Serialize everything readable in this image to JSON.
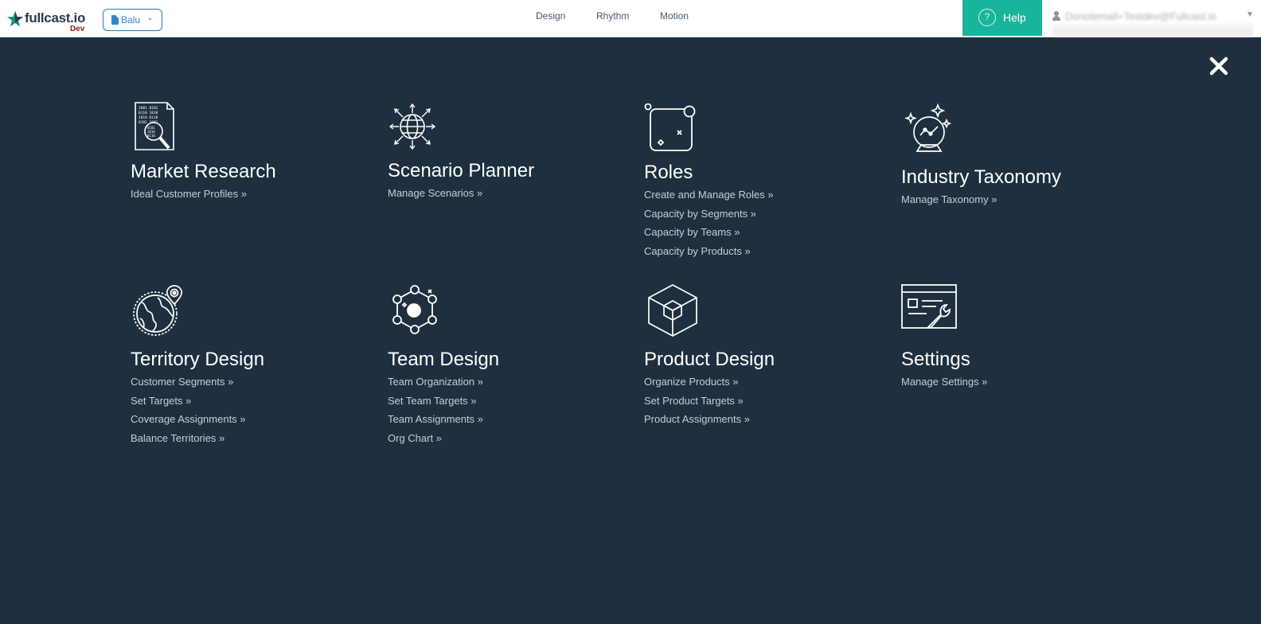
{
  "header": {
    "logo": {
      "name": "fullcast.io",
      "env": "Dev"
    },
    "project_select": {
      "value": "Balu"
    },
    "nav": [
      {
        "label": "Design"
      },
      {
        "label": "Rhythm"
      },
      {
        "label": "Motion"
      }
    ],
    "help": {
      "label": "Help"
    },
    "user": {
      "email": "Donotemail+Testdev@Fullcast.io"
    }
  },
  "colors": {
    "topbar_bg": "#ffffff",
    "overlay_bg": "#1f2f3f",
    "help_bg": "#17b69b",
    "accent_blue": "#2a7ab8",
    "link_text": "#c7ced6"
  },
  "modules": [
    {
      "title": "Market Research",
      "icon": "market-research-icon",
      "links": [
        "Ideal Customer Profiles »"
      ]
    },
    {
      "title": "Scenario Planner",
      "icon": "scenario-planner-icon",
      "links": [
        "Manage Scenarios »"
      ]
    },
    {
      "title": "Roles",
      "icon": "roles-icon",
      "links": [
        "Create and Manage Roles »",
        "Capacity by Segments »",
        "Capacity by Teams »",
        "Capacity by Products »"
      ]
    },
    {
      "title": "Industry Taxonomy",
      "icon": "industry-taxonomy-icon",
      "links": [
        "Manage Taxonomy »"
      ]
    },
    {
      "title": "Territory Design",
      "icon": "territory-design-icon",
      "links": [
        "Customer Segments »",
        "Set Targets »",
        "Coverage Assignments »",
        "Balance Territories »"
      ]
    },
    {
      "title": "Team Design",
      "icon": "team-design-icon",
      "links": [
        "Team Organization »",
        "Set Team Targets »",
        "Team Assignments »",
        "Org Chart »"
      ]
    },
    {
      "title": "Product Design",
      "icon": "product-design-icon",
      "links": [
        "Organize Products »",
        "Set Product Targets »",
        "Product Assignments »"
      ]
    },
    {
      "title": "Settings",
      "icon": "settings-icon",
      "links": [
        "Manage Settings »"
      ]
    }
  ]
}
